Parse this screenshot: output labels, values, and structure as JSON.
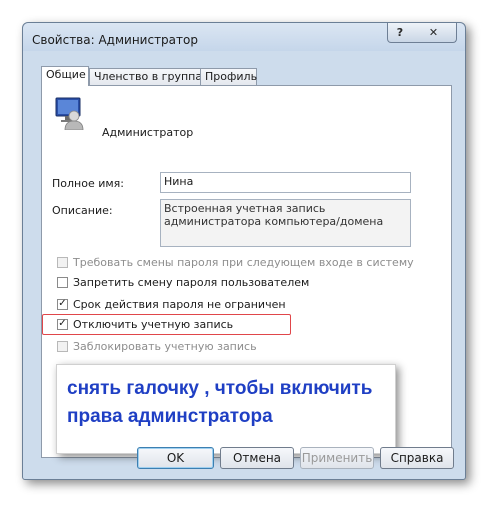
{
  "window": {
    "title": "Свойства: Администратор",
    "help_glyph": "?",
    "close_glyph": "✕"
  },
  "tabs": [
    {
      "label": "Общие",
      "active": true
    },
    {
      "label": "Членство в группах",
      "active": false
    },
    {
      "label": "Профиль",
      "active": false
    }
  ],
  "user": {
    "icon": "user-monitor-icon",
    "name": "Администратор"
  },
  "fields": {
    "full_name_label": "Полное имя:",
    "full_name_value": "Нина",
    "description_label": "Описание:",
    "description_value": "Встроенная учетная запись администратора компьютера/домена"
  },
  "checkboxes": [
    {
      "label": "Требовать смены пароля при следующем входе в систему",
      "checked": false,
      "enabled": false
    },
    {
      "label": "Запретить смену пароля пользователем",
      "checked": false,
      "enabled": true
    },
    {
      "label": "Срок действия пароля не ограничен",
      "checked": true,
      "enabled": true
    },
    {
      "label": "Отключить учетную запись",
      "checked": true,
      "enabled": true
    },
    {
      "label": "Заблокировать учетную запись",
      "checked": false,
      "enabled": false
    }
  ],
  "annotation": {
    "text": "снять галочку , чтобы включить права админстратора",
    "color": "#1f3fc4",
    "highlight_color": "#e0464a"
  },
  "buttons": {
    "ok": "OK",
    "cancel": "Отмена",
    "apply": "Применить",
    "help": "Справка"
  },
  "check_glyph": "✓"
}
